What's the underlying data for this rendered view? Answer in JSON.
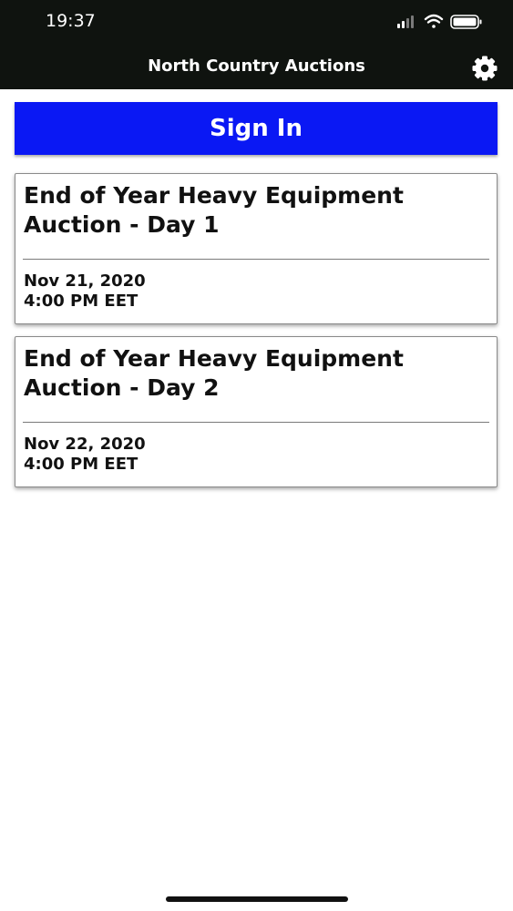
{
  "status_bar": {
    "time": "19:37",
    "icons": [
      "signal-icon",
      "wifi-icon",
      "battery-icon"
    ]
  },
  "header": {
    "title": "North Country Auctions",
    "settings_icon": "gear-icon"
  },
  "sign_in_label": "Sign In",
  "auctions": [
    {
      "title": "End of Year Heavy Equipment Auction - Day 1",
      "date": "Nov 21, 2020",
      "time": "4:00 PM EET"
    },
    {
      "title": "End of Year Heavy Equipment Auction - Day 2",
      "date": "Nov 22, 2020",
      "time": "4:00 PM EET"
    }
  ],
  "colors": {
    "header_bg": "#0f130f",
    "sign_in_bg": "#0a18f4",
    "text": "#111111"
  }
}
